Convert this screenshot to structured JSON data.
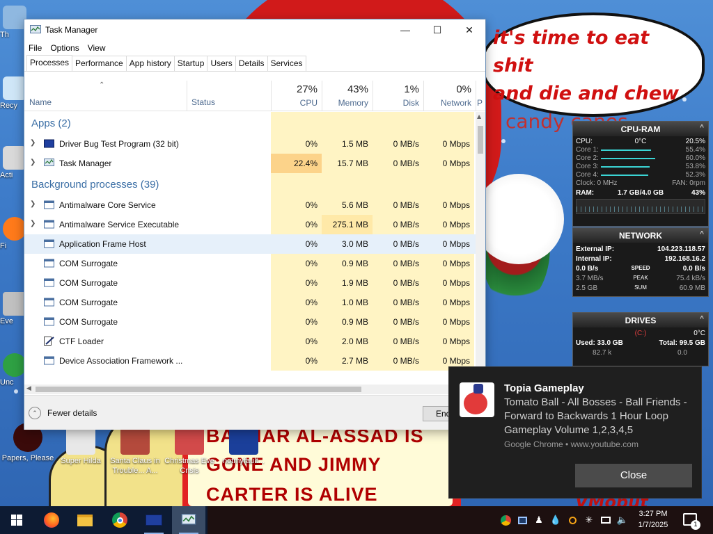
{
  "wallpaper": {
    "speech_bubble_lines": [
      "it's time to eat shit",
      "and die and chew",
      "candy canes"
    ],
    "sign_lines": [
      "BASHAR AL-ASSAD IS",
      "GONE AND JIMMY",
      "CARTER IS ALIVE"
    ],
    "corner_text": "VMobut"
  },
  "desktop_icons": [
    {
      "label": "Papers, Please",
      "icon": "papers-please-icon"
    },
    {
      "label": "Super Hilda",
      "icon": "super-hilda-icon"
    },
    {
      "label": "Santa Claus in Trouble... A...",
      "icon": "santa-claus-game-icon"
    },
    {
      "label": "Christmas Eve Crisis",
      "icon": "christmas-eve-icon"
    },
    {
      "label": "notmyfault...",
      "icon": "notmyfault-icon"
    }
  ],
  "desktop_left_labels": [
    "Th",
    "Recy",
    "Acti",
    "Fi",
    "Eve",
    "Unc"
  ],
  "task_manager": {
    "title": "Task Manager",
    "menu": [
      "File",
      "Options",
      "View"
    ],
    "tabs": [
      "Processes",
      "Performance",
      "App history",
      "Startup",
      "Users",
      "Details",
      "Services"
    ],
    "active_tab": "Processes",
    "columns": {
      "name": "Name",
      "status": "Status",
      "cpu": {
        "pct": "27%",
        "label": "CPU"
      },
      "memory": {
        "pct": "43%",
        "label": "Memory"
      },
      "disk": {
        "pct": "1%",
        "label": "Disk"
      },
      "network": {
        "pct": "0%",
        "label": "Network"
      },
      "power": "P"
    },
    "groups": {
      "apps": "Apps (2)",
      "background": "Background processes (39)"
    },
    "apps": [
      {
        "name": "Driver Bug Test Program (32 bit)",
        "cpu": "0%",
        "memory": "1.5 MB",
        "disk": "0 MB/s",
        "network": "0 Mbps"
      },
      {
        "name": "Task Manager",
        "cpu": "22.4%",
        "memory": "15.7 MB",
        "disk": "0 MB/s",
        "network": "0 Mbps"
      }
    ],
    "background": [
      {
        "name": "Antimalware Core Service",
        "cpu": "0%",
        "memory": "5.6 MB",
        "disk": "0 MB/s",
        "network": "0 Mbps"
      },
      {
        "name": "Antimalware Service Executable",
        "cpu": "0%",
        "memory": "275.1 MB",
        "disk": "0 MB/s",
        "network": "0 Mbps"
      },
      {
        "name": "Application Frame Host",
        "cpu": "0%",
        "memory": "3.0 MB",
        "disk": "0 MB/s",
        "network": "0 Mbps"
      },
      {
        "name": "COM Surrogate",
        "cpu": "0%",
        "memory": "0.9 MB",
        "disk": "0 MB/s",
        "network": "0 Mbps"
      },
      {
        "name": "COM Surrogate",
        "cpu": "0%",
        "memory": "1.9 MB",
        "disk": "0 MB/s",
        "network": "0 Mbps"
      },
      {
        "name": "COM Surrogate",
        "cpu": "0%",
        "memory": "1.0 MB",
        "disk": "0 MB/s",
        "network": "0 Mbps"
      },
      {
        "name": "COM Surrogate",
        "cpu": "0%",
        "memory": "0.9 MB",
        "disk": "0 MB/s",
        "network": "0 Mbps"
      },
      {
        "name": "CTF Loader",
        "cpu": "0%",
        "memory": "2.0 MB",
        "disk": "0 MB/s",
        "network": "0 Mbps"
      },
      {
        "name": "Device Association Framework ...",
        "cpu": "0%",
        "memory": "2.7 MB",
        "disk": "0 MB/s",
        "network": "0 Mbps"
      }
    ],
    "fewer_details": "Fewer details",
    "end_task": "End task"
  },
  "gadget_cpu": {
    "title": "CPU-RAM",
    "cpu_label": "CPU:",
    "temp": "0°C",
    "cpu_pct": "20.5%",
    "cores": [
      {
        "label": "Core 1:",
        "value": "55.4%",
        "level": 0.554
      },
      {
        "label": "Core 2:",
        "value": "60.0%",
        "level": 0.6
      },
      {
        "label": "Core 3:",
        "value": "53.8%",
        "level": 0.538
      },
      {
        "label": "Core 4:",
        "value": "52.3%",
        "level": 0.523
      }
    ],
    "clock": "Clock: 0 MHz",
    "fan": "FAN: 0rpm",
    "ram_label": "RAM:",
    "ram": "1.7 GB/4.0 GB",
    "ram_pct": "43%"
  },
  "gadget_net": {
    "title": "NETWORK",
    "external_label": "External IP:",
    "external_ip": "104.223.118.57",
    "internal_label": "Internal IP:",
    "internal_ip": "192.168.16.2",
    "speed_left": "0.0 B/s",
    "speed_label": "SPEED",
    "speed_right": "0.0 B/s",
    "peak_left": "3.7 MB/s",
    "peak_label": "PEAK",
    "peak_right": "75.4 kB/s",
    "sum_left": "2.5 GB",
    "sum_label": "SUM",
    "sum_right": "60.9 MB"
  },
  "gadget_drives": {
    "title": "DRIVES",
    "drive": "(C:)",
    "temp": "0°C",
    "used": "Used: 33.0 GB",
    "total": "Total: 99.5 GB",
    "read": "82.7 k",
    "write": "0.0"
  },
  "notification": {
    "title": "Topia Gameplay",
    "body": "Tomato Ball - All Bosses - Ball Friends - Forward to Backwards 1 Hour Loop Gameplay Volume 1,2,3,4,5",
    "source": "Google Chrome • www.youtube.com",
    "close": "Close"
  },
  "taskbar": {
    "time": "3:27 PM",
    "date": "1/7/2025",
    "notification_count": "1"
  }
}
